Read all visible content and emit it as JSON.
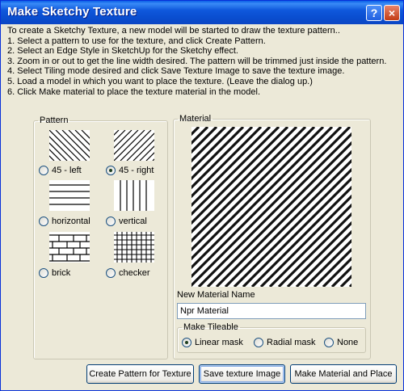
{
  "window": {
    "title": "Make Sketchy Texture",
    "help_label": "?",
    "close_label": "×"
  },
  "instructions": [
    "To create a Sketchy Texture, a new model will be started to draw the texture pattern..",
    "1. Select a pattern to use for the texture, and click Create Pattern.",
    "2. Select an Edge Style in SketchUp for the Sketchy effect.",
    "3. Zoom in or out to get the line width desired. The pattern will be trimmed just inside the pattern.",
    "4. Select Tiling mode desired and click Save Texture Image to save the texture image.",
    "5. Load a model in which you want to place the texture. (Leave the dialog up.)",
    "6. Click Make material to place the texture material in the model."
  ],
  "pattern": {
    "legend": "Pattern",
    "options": [
      {
        "label": "45 - left",
        "icon": "diagonal-left-lines-icon",
        "selected": false
      },
      {
        "label": "45 - right",
        "icon": "diagonal-right-lines-icon",
        "selected": true
      },
      {
        "label": "horizontal",
        "icon": "horizontal-lines-icon",
        "selected": false
      },
      {
        "label": "vertical",
        "icon": "vertical-lines-icon",
        "selected": false
      },
      {
        "label": "brick",
        "icon": "brick-pattern-icon",
        "selected": false
      },
      {
        "label": "checker",
        "icon": "checker-grid-icon",
        "selected": false
      }
    ]
  },
  "material": {
    "legend": "Material",
    "preview_icon": "diagonal-texture-preview",
    "name_label": "New Material Name",
    "name_value": "Npr Material",
    "tileable": {
      "legend": "Make Tileable",
      "options": [
        {
          "label": "Linear mask",
          "selected": true
        },
        {
          "label": "Radial mask",
          "selected": false
        },
        {
          "label": "None",
          "selected": false
        }
      ]
    }
  },
  "buttons": {
    "create": "Create Pattern for Texture",
    "save": "Save texture Image",
    "make": "Make Material and Place"
  }
}
